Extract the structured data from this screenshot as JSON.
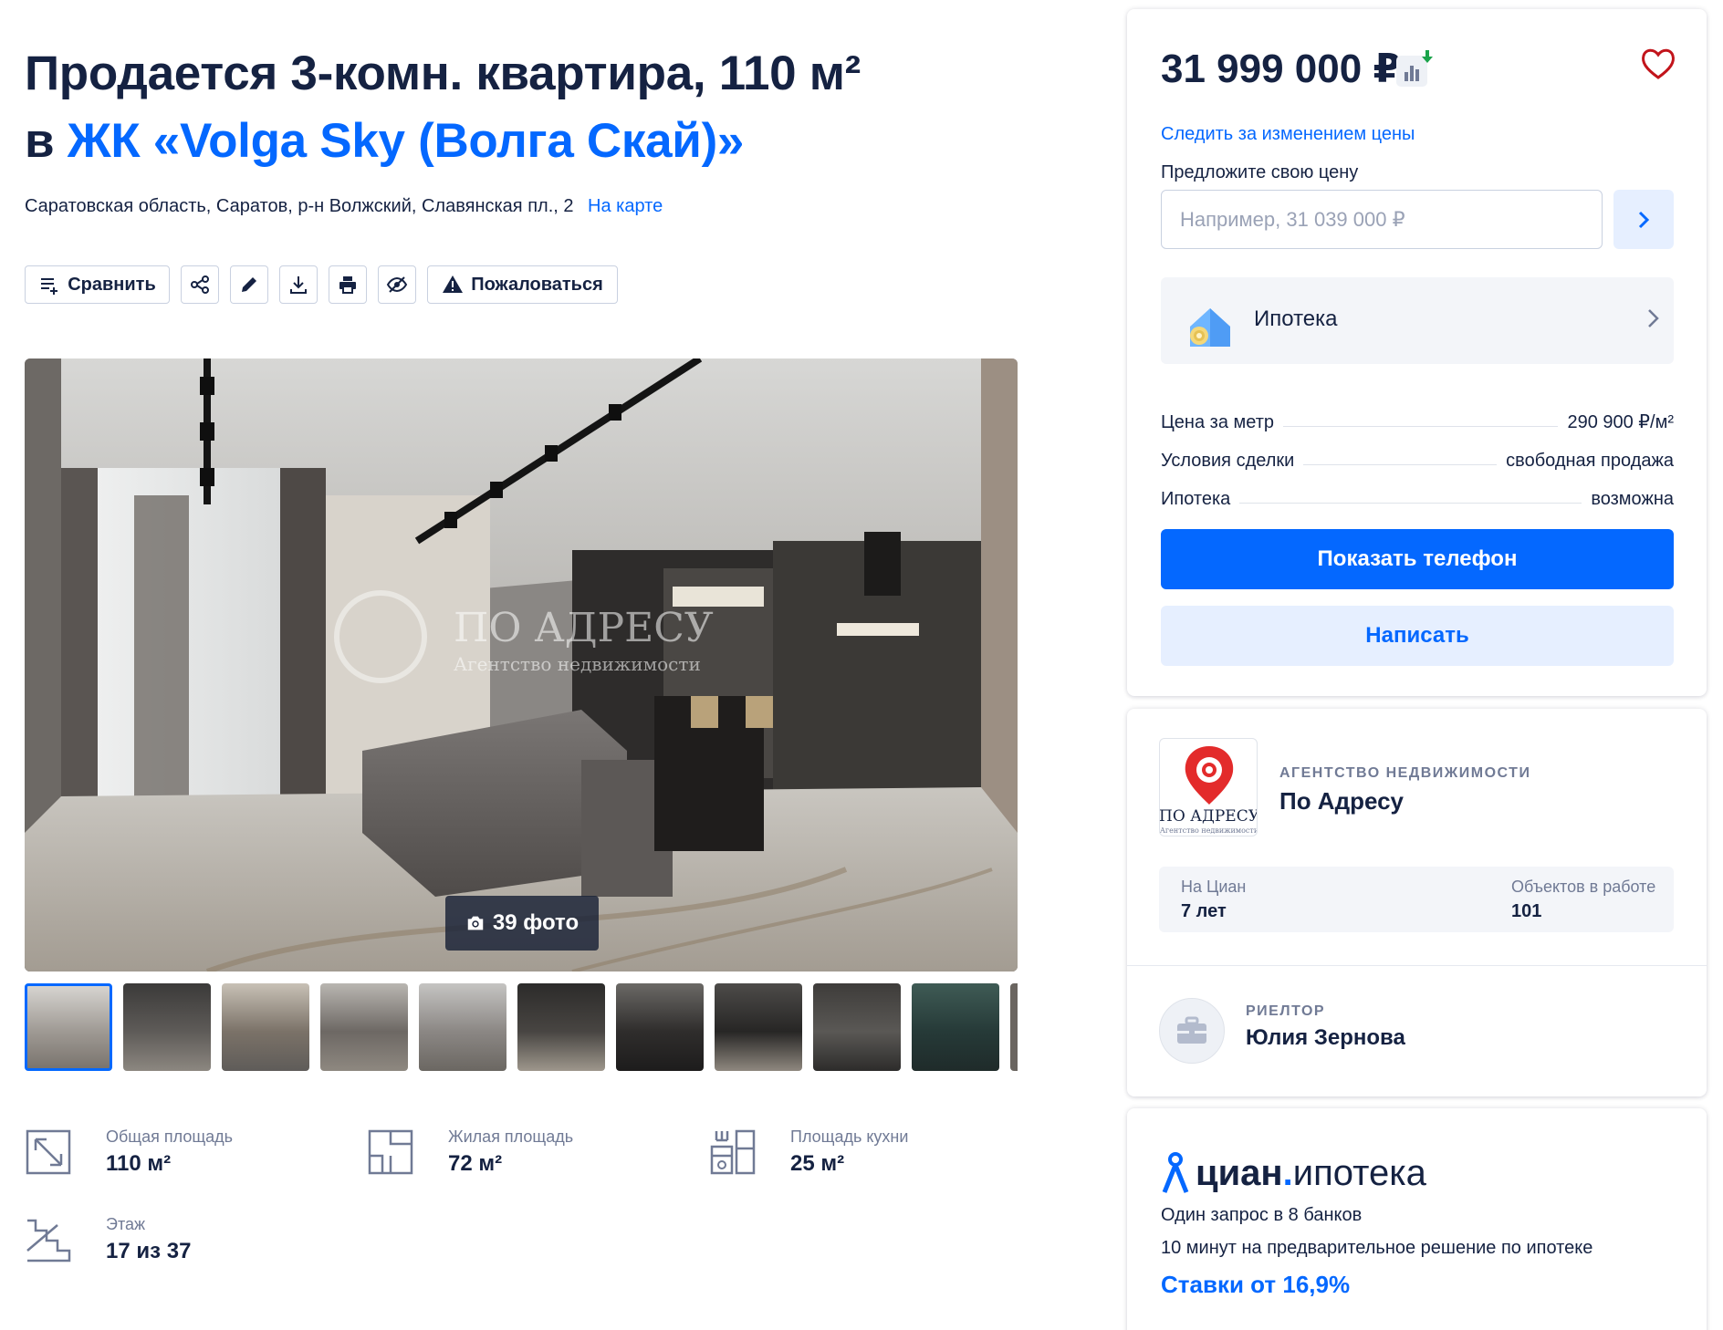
{
  "listing": {
    "title_prefix": "Продается 3-комн. квартира, 110 м²",
    "title_in": "в ",
    "title_link": "ЖК «Volga Sky (Волга Скай)»",
    "address": "Саратовская область, Саратов, р-н Волжский, Славянская пл., 2",
    "map_link": "На карте"
  },
  "toolbar": {
    "compare_label": "Сравнить",
    "complain_label": "Пожаловаться"
  },
  "gallery": {
    "photo_count_label": "39 фото",
    "watermark_title": "ПО АДРЕСУ",
    "watermark_subtitle": "Агентство недвижимости",
    "thumbnails_count": 10,
    "active_index": 0
  },
  "facts": {
    "total_area_label": "Общая площадь",
    "total_area_value": "110 м²",
    "living_area_label": "Жилая площадь",
    "living_area_value": "72 м²",
    "kitchen_area_label": "Площадь кухни",
    "kitchen_area_value": "25 м²",
    "floor_label": "Этаж",
    "floor_value": "17 из 37"
  },
  "price_card": {
    "price": "31 999 000 ₽",
    "follow_price": "Следить за изменением цены",
    "offer_label": "Предложите свою цену",
    "offer_placeholder": "Например, 31 039 000 ₽",
    "mortgage_label": "Ипотека",
    "rows": [
      {
        "label": "Цена за метр",
        "value": "290 900 ₽/м²"
      },
      {
        "label": "Условия сделки",
        "value": "свободная продажа"
      },
      {
        "label": "Ипотека",
        "value": "возможна"
      }
    ],
    "show_phone": "Показать телефон",
    "write": "Написать"
  },
  "agency": {
    "kind": "АГЕНТСТВО НЕДВИЖИМОСТИ",
    "name": "По Адресу",
    "logo_text": "ПО АДРЕСУ",
    "logo_subtext": "Агентство недвижимости",
    "on_cian_label": "На Циан",
    "on_cian_value": "7 лет",
    "objects_label": "Объектов в работе",
    "objects_value": "101",
    "realtor_kind": "РИЕЛТОР",
    "realtor_name": "Юлия Зернова"
  },
  "cian_mortgage": {
    "logo_word1": "циан",
    "logo_dot": ".",
    "logo_word2": "ипотека",
    "line1": "Один запрос в 8 банков",
    "line2": "10 минут на предварительное решение по ипотеке",
    "rate": "Ставки от 16,9%"
  },
  "colors": {
    "accent": "#0468ff",
    "text": "#152242",
    "muted": "#707a95",
    "favorite": "#c2141b",
    "price_down": "#1aa34a"
  }
}
